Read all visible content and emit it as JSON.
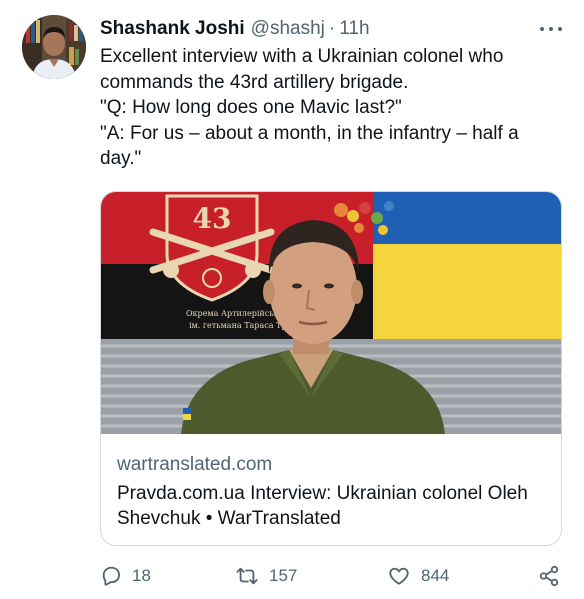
{
  "author": {
    "display_name": "Shashank Joshi",
    "handle": "@shashj",
    "separator": "·",
    "time": "11h"
  },
  "tweet": {
    "lines": [
      "Excellent interview with a Ukrainian colonel who commands the 43rd artillery brigade.",
      "\"Q: How long does one Mavic last?\"",
      "\"A: For us – about a month, in the infantry – half a day.\""
    ]
  },
  "card": {
    "domain": "wartranslated.com",
    "title": "Pravda.com.ua Interview: Ukrainian colonel Oleh Shevchuk • WarTranslated",
    "image": {
      "flag_number": "43",
      "flag_caption_line1": "Окрема Артилерійська Бригада",
      "flag_caption_line2": "ім. гетьмана Тараса Трясила",
      "colors": {
        "flag_red": "#c8202a",
        "flag_black": "#141414",
        "ua_blue": "#1f5fb4",
        "ua_yellow": "#f4d53d",
        "uniform": "#4e5a2e"
      }
    }
  },
  "actions": {
    "reply": {
      "icon": "reply-icon",
      "count": "18"
    },
    "retweet": {
      "icon": "retweet-icon",
      "count": "157"
    },
    "like": {
      "icon": "heart-icon",
      "count": "844"
    },
    "share": {
      "icon": "share-icon"
    }
  },
  "theme": {
    "text_primary": "#0f1419",
    "text_secondary": "#536471",
    "border": "#cfd9de"
  }
}
